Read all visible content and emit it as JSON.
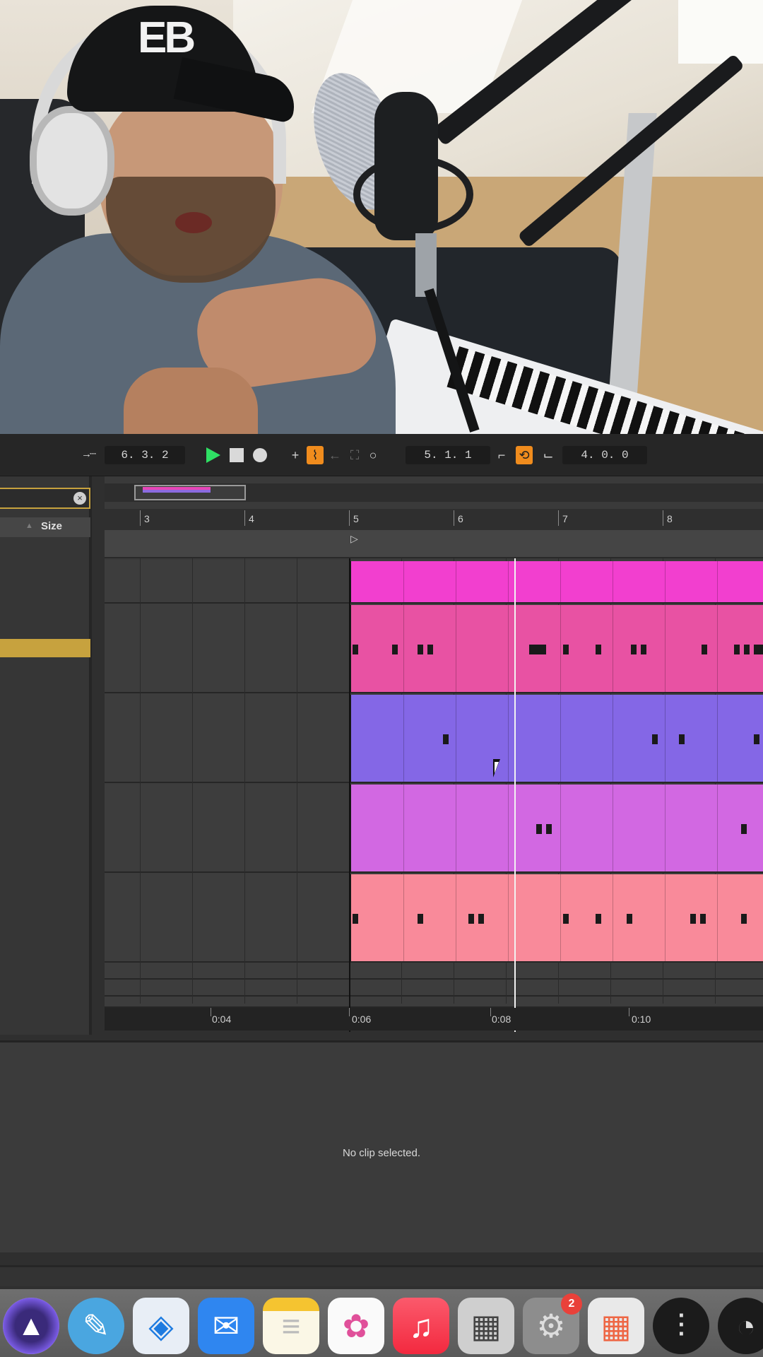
{
  "transport": {
    "arrangement_position": "6.  3.  2",
    "loop_start": "5.  1.  1",
    "loop_length": "4.  0.  0"
  },
  "browser": {
    "size_column": "Size"
  },
  "arrangement": {
    "bar_numbers": [
      "3",
      "4",
      "5",
      "6",
      "7",
      "8"
    ],
    "time_labels": [
      "0:04",
      "0:06",
      "0:08",
      "0:10"
    ]
  },
  "tracks": [
    {
      "color": "#f23fcf"
    },
    {
      "color": "#e852a3"
    },
    {
      "color": "#8467e6"
    },
    {
      "color": "#d268e2"
    },
    {
      "color": "#f98a9a"
    }
  ],
  "detail": {
    "message": "No clip selected."
  },
  "dock": {
    "apps": [
      {
        "icon": "pro-tools-icon"
      },
      {
        "icon": "app-store-alt-icon"
      },
      {
        "icon": "safari-icon"
      },
      {
        "icon": "mail-icon"
      },
      {
        "icon": "notes-icon"
      },
      {
        "icon": "photos-icon"
      },
      {
        "icon": "music-icon"
      },
      {
        "icon": "calculator-icon"
      },
      {
        "icon": "system-preferences-icon",
        "badge": "2"
      },
      {
        "icon": "launchpad-icon"
      },
      {
        "icon": "ua-console-icon"
      },
      {
        "icon": "ua-meter-icon"
      }
    ]
  }
}
